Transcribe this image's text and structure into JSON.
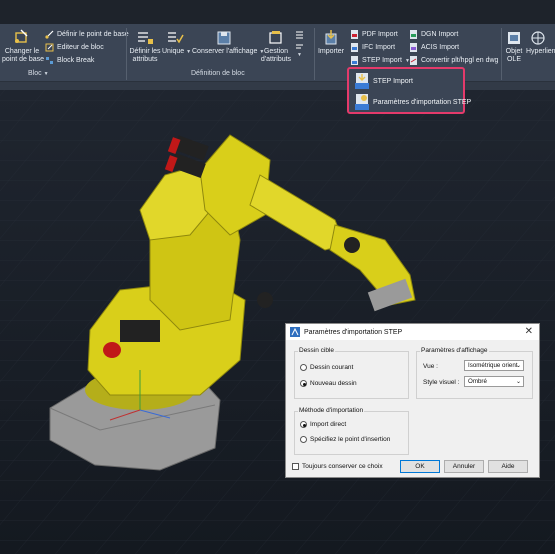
{
  "ribbon": {
    "bloc_panel": {
      "change_base": [
        "Changer le",
        "point de base"
      ],
      "define_base": "Définir le point de base",
      "block_editor": "Editeur de bloc",
      "block_break": "Block Break",
      "title": "Bloc"
    },
    "definition_panel": {
      "define_attrs": [
        "Définir les",
        "attributs"
      ],
      "unique": "Unique",
      "save_display": "Conserver l'affichage",
      "manage_attrs": [
        "Gestion",
        "d'attributs"
      ],
      "title": "Définition de bloc"
    },
    "import_panel": {
      "import": "Importer",
      "pdf": "PDF Import",
      "ifc": "IFC Import",
      "step": "STEP Import",
      "dgn": "DGN Import",
      "acis": "ACIS Import",
      "convert": "Convertir plt/hpgl en dwg"
    },
    "ole": [
      "Objet",
      "OLE"
    ],
    "hyperlink": "Hyperlien"
  },
  "popup": {
    "step_import": "STEP Import",
    "step_params": "Paramètres d'importation STEP"
  },
  "dialog": {
    "title": "Paramètres d'importation STEP",
    "target_group": "Dessin cible",
    "current_drawing": "Dessin courant",
    "new_drawing": "Nouveau dessin",
    "display_group": "Paramètres d'affichage",
    "view_label": "Vue :",
    "view_value": "Isométrique orient",
    "visual_style_label": "Style visuel :",
    "visual_style_value": "Ombré",
    "method_group": "Méthode d'importation",
    "direct_import": "Import direct",
    "specify_point": "Spécifiez le point d'insertion",
    "always_keep": "Toujours conserver ce choix",
    "ok": "OK",
    "cancel": "Annuler",
    "help": "Aide"
  },
  "colors": {
    "ribbon": "#3b4555",
    "highlight": "#e43a6b",
    "robot": "#d9cf1a",
    "viewport": "#1a2029"
  }
}
